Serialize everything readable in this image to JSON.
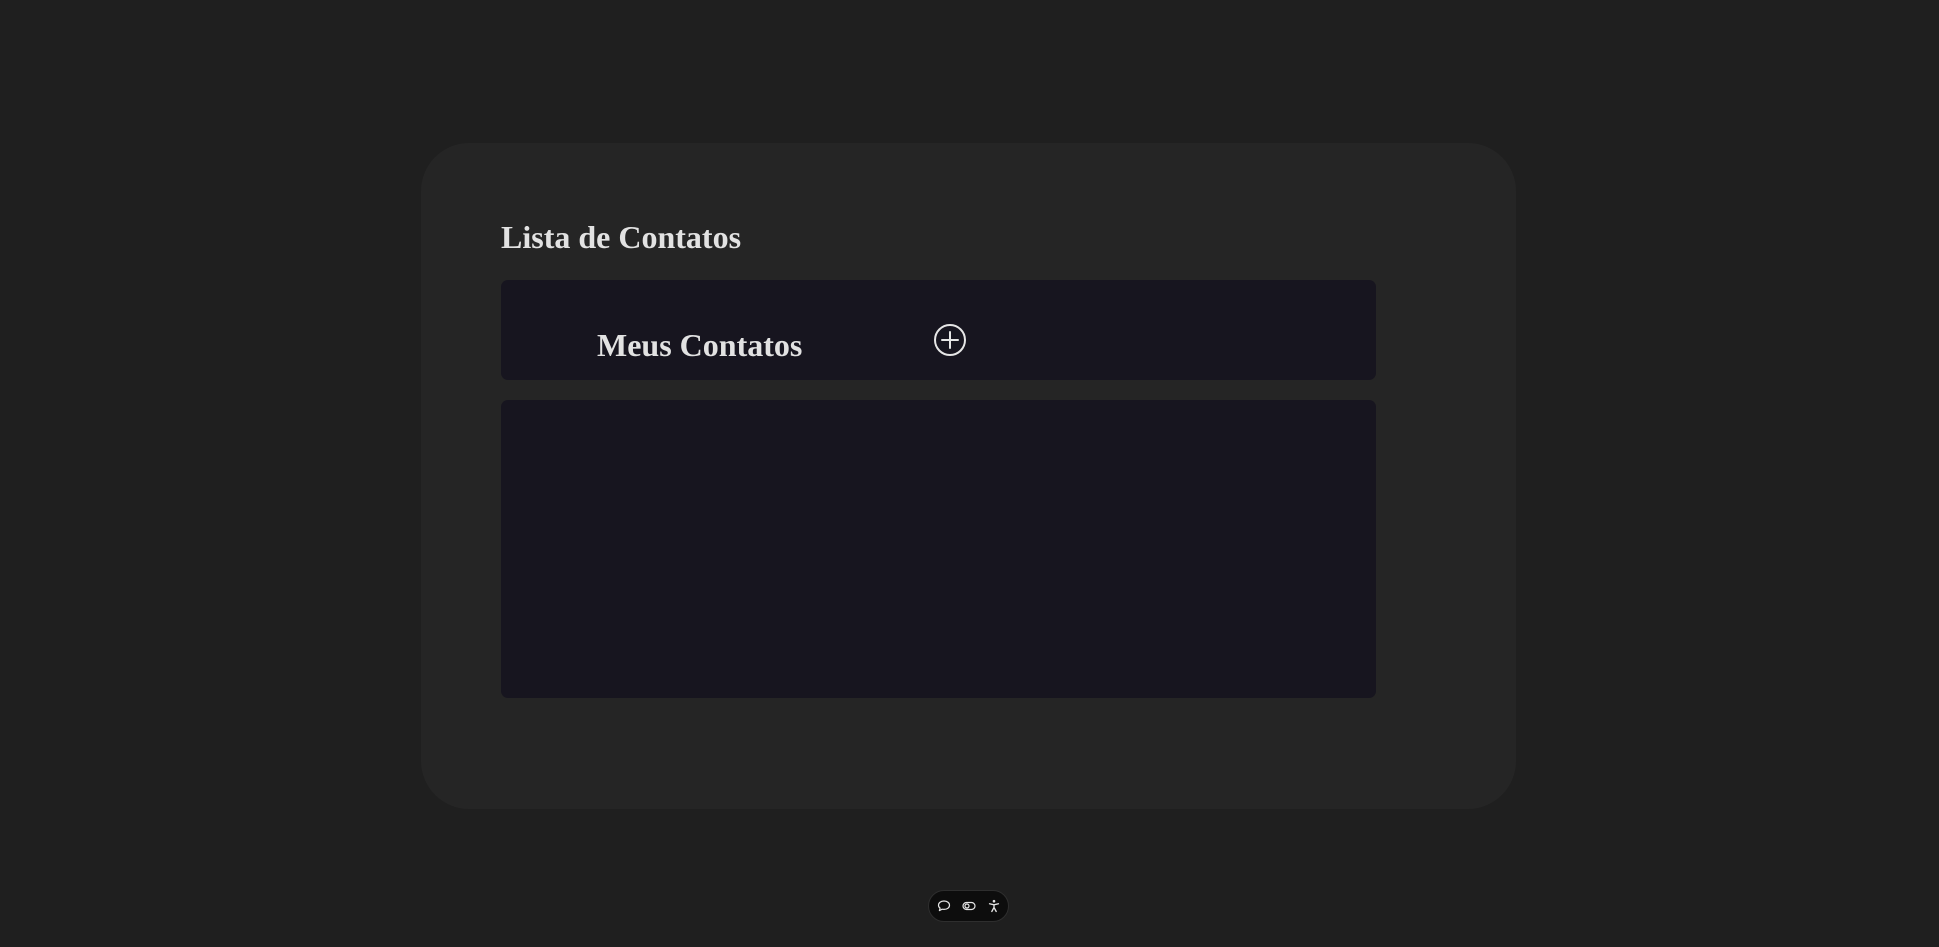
{
  "page": {
    "title": "Lista de Contatos"
  },
  "contacts_header": {
    "title": "Meus Contatos",
    "add_icon": "plus-circle-icon"
  },
  "contacts_list": {
    "items": []
  },
  "toolbar": {
    "icons": [
      "chat-bubble-icon",
      "toggle-icon",
      "accessibility-icon"
    ]
  },
  "colors": {
    "background": "#1f1f1f",
    "card": "#252525",
    "panel": "#17151f",
    "text": "#e2e2e2",
    "toolbar": "#0d0d0d"
  }
}
